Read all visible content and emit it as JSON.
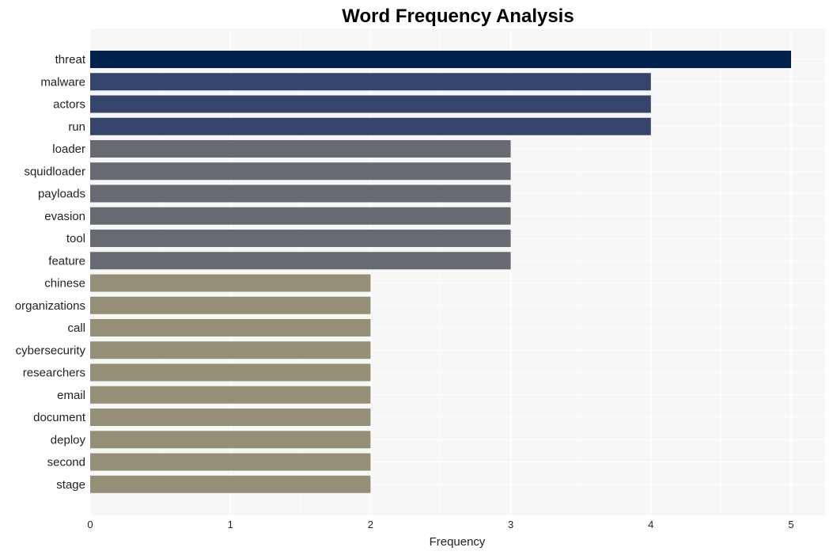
{
  "chart_data": {
    "type": "bar",
    "orientation": "horizontal",
    "title": "Word Frequency Analysis",
    "xlabel": "Frequency",
    "ylabel": "",
    "xlim": [
      0,
      5.25
    ],
    "xticks": [
      0,
      1,
      2,
      3,
      4,
      5
    ],
    "grid": true,
    "legend": "none",
    "categories": [
      "threat",
      "malware",
      "actors",
      "run",
      "loader",
      "squidloader",
      "payloads",
      "evasion",
      "tool",
      "feature",
      "chinese",
      "organizations",
      "call",
      "cybersecurity",
      "researchers",
      "email",
      "document",
      "deploy",
      "second",
      "stage"
    ],
    "values": [
      5,
      4,
      4,
      4,
      3,
      3,
      3,
      3,
      3,
      3,
      2,
      2,
      2,
      2,
      2,
      2,
      2,
      2,
      2,
      2
    ],
    "colors": {
      "5": "#00204e",
      "4": "#35446b",
      "3": "#686a71",
      "2": "#958f78"
    },
    "background": "#f7f7f7"
  }
}
